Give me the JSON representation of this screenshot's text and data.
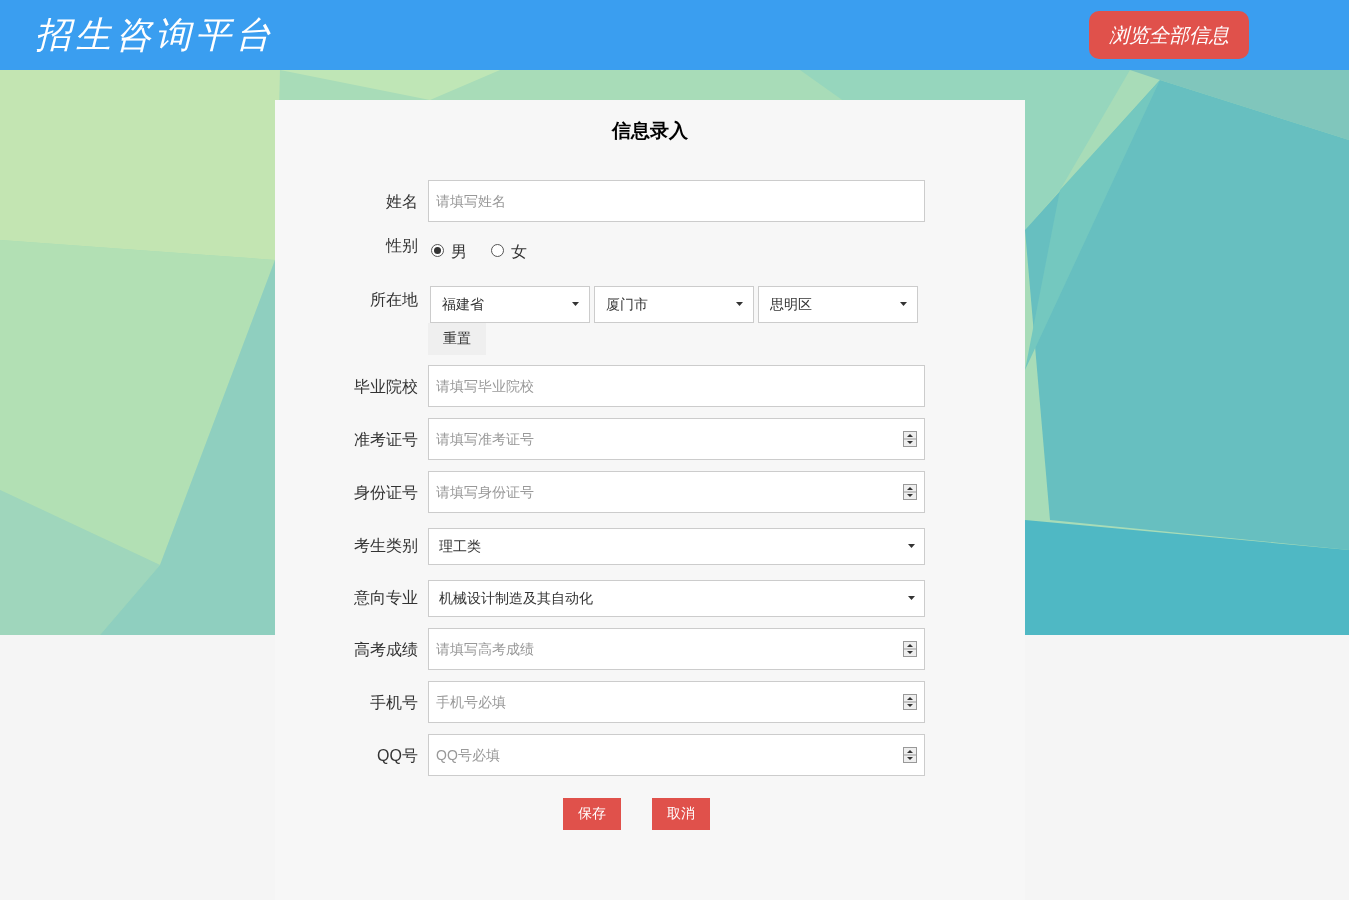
{
  "header": {
    "title": "招生咨询平台",
    "browse_button": "浏览全部信息"
  },
  "form": {
    "title": "信息录入",
    "fields": [
      {
        "kind": "text",
        "label": "姓名",
        "placeholder": "请填写姓名"
      },
      {
        "kind": "radio",
        "label": "性别",
        "options": [
          {
            "label": "男",
            "selected": true
          },
          {
            "label": "女",
            "selected": false
          }
        ]
      },
      {
        "kind": "location",
        "label": "所在地",
        "selects": [
          "福建省",
          "厦门市",
          "思明区"
        ],
        "reset_button": "重置"
      },
      {
        "kind": "text",
        "label": "毕业院校",
        "placeholder": "请填写毕业院校"
      },
      {
        "kind": "number",
        "label": "准考证号",
        "placeholder": "请填写准考证号"
      },
      {
        "kind": "number",
        "label": "身份证号",
        "placeholder": "请填写身份证号"
      },
      {
        "kind": "select",
        "label": "考生类别",
        "value": "理工类"
      },
      {
        "kind": "select",
        "label": "意向专业",
        "value": "机械设计制造及其自动化"
      },
      {
        "kind": "number",
        "label": "高考成绩",
        "placeholder": "请填写高考成绩"
      },
      {
        "kind": "number",
        "label": "手机号",
        "placeholder": "手机号必填"
      },
      {
        "kind": "number",
        "label": "QQ号",
        "placeholder": "QQ号必填"
      }
    ],
    "buttons": [
      {
        "label": "保存"
      },
      {
        "label": "取消"
      }
    ]
  }
}
